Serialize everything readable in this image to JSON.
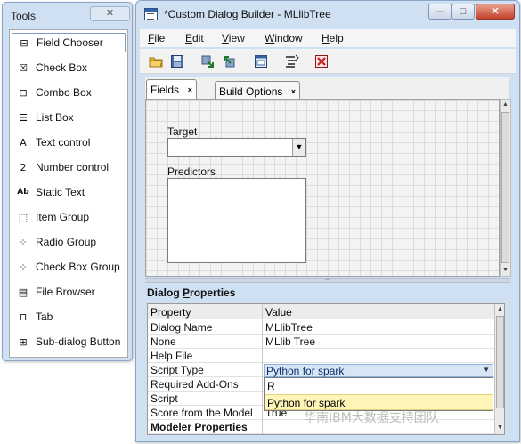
{
  "tools": {
    "title": "Tools",
    "close_glyph": "✕",
    "items": [
      {
        "label": "Field Chooser",
        "icon": "field-chooser-icon",
        "glyph": "⊟"
      },
      {
        "label": "Check Box",
        "icon": "check-box-icon",
        "glyph": "☒"
      },
      {
        "label": "Combo Box",
        "icon": "combo-box-icon",
        "glyph": "⊟"
      },
      {
        "label": "List Box",
        "icon": "list-box-icon",
        "glyph": "☰"
      },
      {
        "label": "Text control",
        "icon": "text-control-icon",
        "glyph": "A"
      },
      {
        "label": "Number control",
        "icon": "number-control-icon",
        "glyph": "2"
      },
      {
        "label": "Static Text",
        "icon": "static-text-icon",
        "glyph": "Ab"
      },
      {
        "label": "Item Group",
        "icon": "item-group-icon",
        "glyph": "⬚"
      },
      {
        "label": "Radio Group",
        "icon": "radio-group-icon",
        "glyph": "⁘"
      },
      {
        "label": "Check Box Group",
        "icon": "check-box-group-icon",
        "glyph": "⁘"
      },
      {
        "label": "File Browser",
        "icon": "file-browser-icon",
        "glyph": "▤"
      },
      {
        "label": "Tab",
        "icon": "tab-icon",
        "glyph": "⊓"
      },
      {
        "label": "Sub-dialog Button",
        "icon": "sub-dialog-button-icon",
        "glyph": "⊞"
      }
    ]
  },
  "window": {
    "title": "*Custom Dialog Builder - MLlibTree",
    "minimize_glyph": "—",
    "maximize_glyph": "□",
    "close_glyph": "✕"
  },
  "menu": {
    "file": {
      "u": "F",
      "rest": "ile"
    },
    "edit": {
      "u": "E",
      "rest": "dit"
    },
    "view": {
      "u": "V",
      "rest": "iew"
    },
    "window": {
      "u": "W",
      "rest": "indow"
    },
    "help": {
      "u": "H",
      "rest": "elp"
    }
  },
  "toolbar_icons": [
    "open-folder-icon",
    "save-icon",
    "install-icon",
    "uninstall-icon",
    "preview-icon",
    "syntax-template-icon",
    "delete-icon"
  ],
  "tabs": {
    "fields": "Fields",
    "build_options": "Build Options",
    "close_glyph": "×"
  },
  "canvas": {
    "target_label": "Target",
    "target_caret": "▼",
    "predictors_label": "Predictors"
  },
  "splitter_dots": "•••",
  "properties": {
    "header_prefix": "Dialog ",
    "header_underlined": "P",
    "header_suffix": "roperties",
    "col_property": "Property",
    "col_value": "Value",
    "rows": [
      {
        "key": "Dialog Name",
        "value": "MLlibTree"
      },
      {
        "key": "None",
        "value": "MLlib Tree"
      },
      {
        "key": "Help File",
        "value": ""
      },
      {
        "key": "Script Type",
        "value": ""
      },
      {
        "key": "Required Add-Ons",
        "value": ""
      },
      {
        "key": "Script",
        "value": ""
      },
      {
        "key": "Score from the Model",
        "value": "True"
      },
      {
        "key": "Modeler Properties",
        "value": ""
      }
    ],
    "script_type_selected": "Python for spark",
    "script_type_caret": "▼",
    "dropdown_options": [
      "R",
      "Python for spark"
    ],
    "dropdown_selected_index": 1
  },
  "scroll": {
    "up": "▲",
    "down": "▼"
  },
  "watermark": "华南IBM大数据支持团队"
}
